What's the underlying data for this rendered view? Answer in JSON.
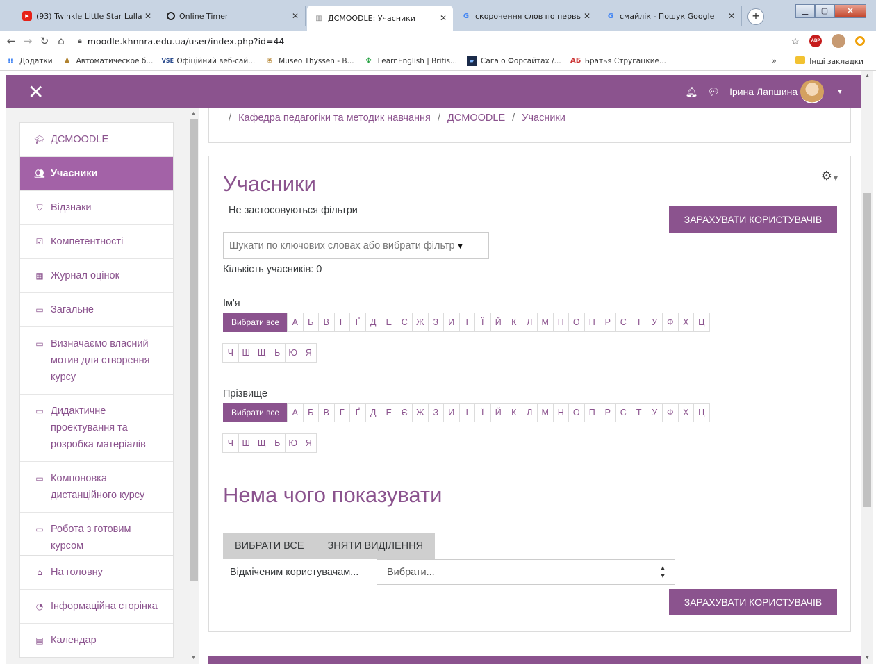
{
  "browser": {
    "tabs": [
      {
        "title": "(93) Twinkle Little Star Lullab",
        "icon": "youtube-icon"
      },
      {
        "title": "Online Timer",
        "icon": "timer-icon"
      },
      {
        "title": "ДСMOODLE: Учасники",
        "icon": "moodle-icon"
      },
      {
        "title": "скорочення слов по первы",
        "icon": "google-icon"
      },
      {
        "title": "смайлік - Пошук Google",
        "icon": "google-icon"
      }
    ],
    "url": "moodle.khnnra.edu.ua/user/index.php?id=44",
    "bookmarks": [
      "Додатки",
      "Автоматическое б...",
      "Офіційний веб-сай...",
      "Museo Thyssen - B...",
      "LearnEnglish | Britis...",
      "Сага о Форсайтах /...",
      "Братья Стругацкие..."
    ],
    "bookmarks_more": "»",
    "other_bookmarks": "Інші закладки"
  },
  "navbar": {
    "user_name": "Ірина Лапшина"
  },
  "drawer": {
    "course": [
      {
        "label": "ДСMOODLE",
        "icon": "graduation-cap-icon",
        "active": false
      },
      {
        "label": "Учасники",
        "icon": "users-icon",
        "active": true
      },
      {
        "label": "Відзнаки",
        "icon": "shield-icon",
        "active": false
      },
      {
        "label": "Компетентності",
        "icon": "checkbox-icon",
        "active": false
      },
      {
        "label": "Журнал оцінок",
        "icon": "table-icon",
        "active": false
      },
      {
        "label": "Загальне",
        "icon": "folder-icon",
        "active": false
      },
      {
        "label": "Визначаємо власний мотив для створення курсу",
        "icon": "folder-icon",
        "active": false
      },
      {
        "label": "Дидактичне проектування та розробка матеріалів",
        "icon": "folder-icon",
        "active": false
      },
      {
        "label": "Компоновка дистанційного курсу",
        "icon": "folder-icon",
        "active": false
      },
      {
        "label": "Робота з готовим курсом",
        "icon": "folder-icon",
        "active": false
      }
    ],
    "site": [
      {
        "label": "На головну",
        "icon": "home-icon"
      },
      {
        "label": "Інформаційна сторінка",
        "icon": "dashboard-icon"
      },
      {
        "label": "Календар",
        "icon": "calendar-icon"
      }
    ]
  },
  "breadcrumb": {
    "items": [
      "Кафедра педагогіки та методик навчання",
      "ДСMOODLE",
      "Учасники"
    ]
  },
  "main": {
    "title": "Учасники",
    "no_filters": "Не застосовуються фільтри",
    "enrol_button": "Зарахувати користувачів",
    "search_placeholder": "Шукати по ключових словах або вибрати фільтр",
    "participants_count": "Кількість учасників: 0",
    "firstname_label": "Ім'я",
    "lastname_label": "Прізвище",
    "select_all_letter": "Вибрати все",
    "letters": [
      "А",
      "Б",
      "В",
      "Г",
      "Ґ",
      "Д",
      "Е",
      "Є",
      "Ж",
      "З",
      "И",
      "І",
      "Ї",
      "Й",
      "К",
      "Л",
      "М",
      "Н",
      "О",
      "П",
      "Р",
      "С",
      "Т",
      "У",
      "Ф",
      "Х",
      "Ц",
      "Ч",
      "Ш",
      "Щ",
      "Ь",
      "Ю",
      "Я"
    ],
    "nothing_to_display": "Нема чого показувати",
    "select_all_button": "Вибрати все",
    "deselect_all_button": "Зняти виділення",
    "with_selected_label": "Відміченим користувачам...",
    "with_selected_value": "Вибрати..."
  },
  "colors": {
    "brand": "#8b538e",
    "active_nav": "#a362a7"
  }
}
